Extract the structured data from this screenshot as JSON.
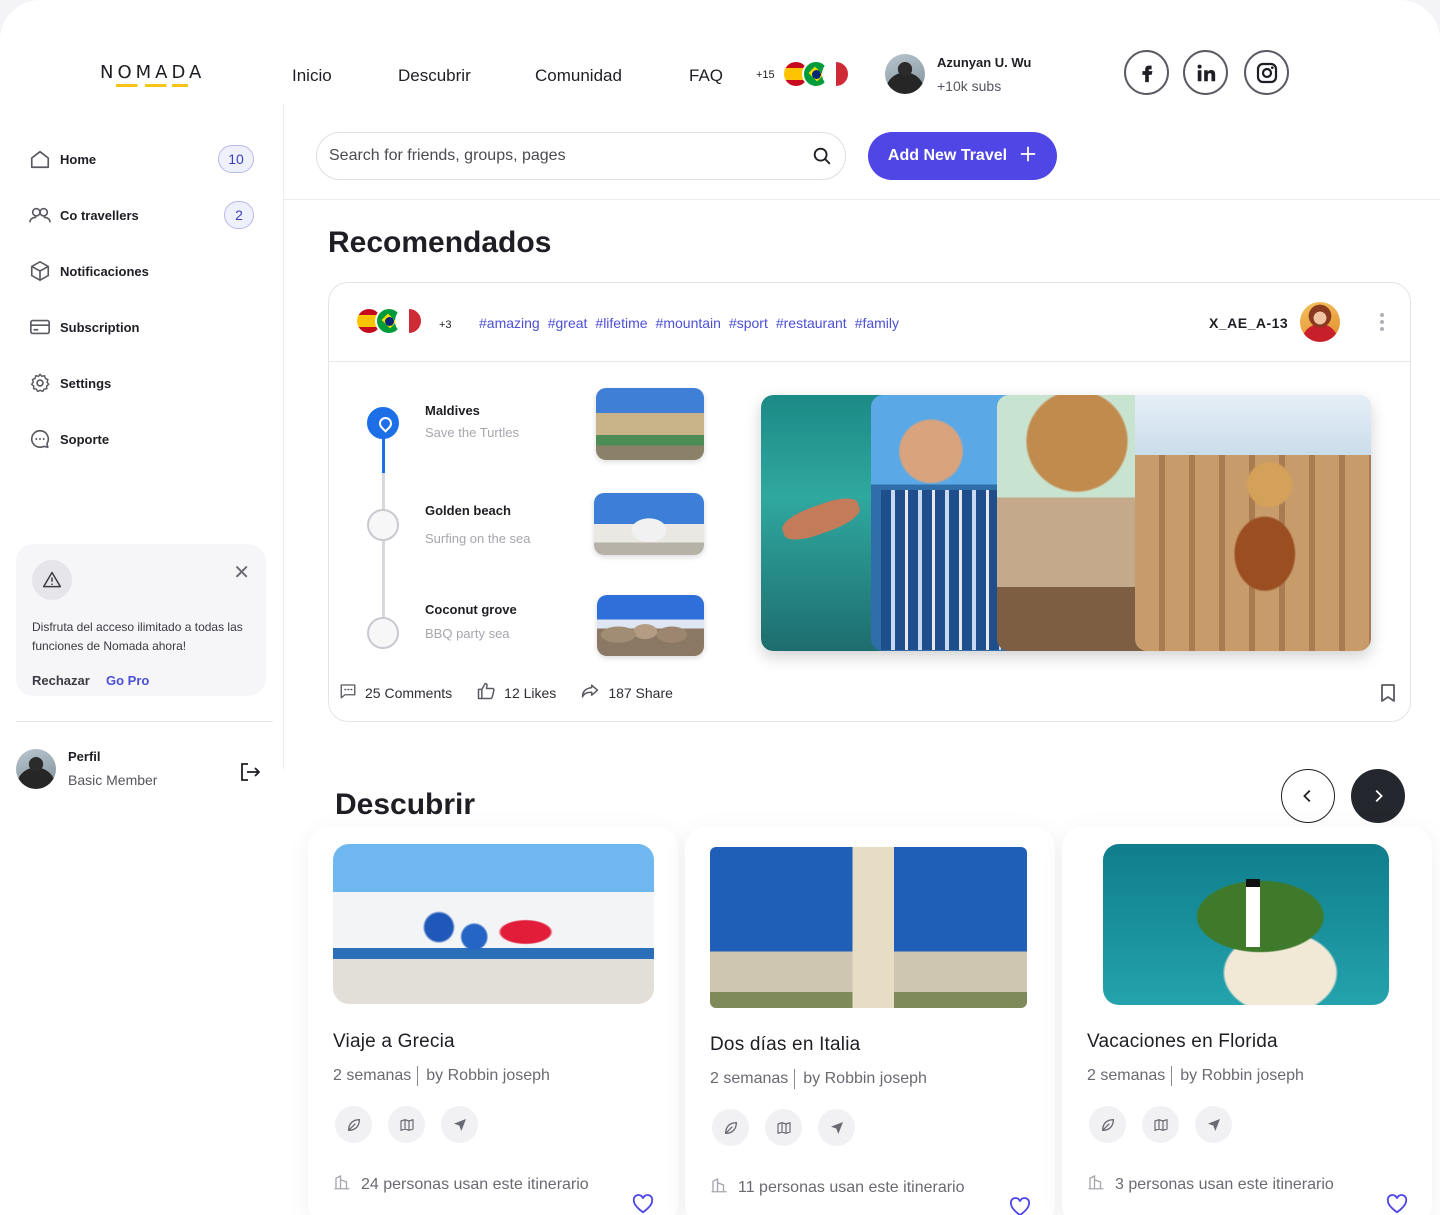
{
  "brand": {
    "logo_text": "NOMADA",
    "accent": "#4f46e5",
    "logo_accent": "#f5c518"
  },
  "nav": {
    "items": [
      "Inicio",
      "Descubrir",
      "Comunidad",
      "FAQ"
    ]
  },
  "languages": {
    "extra_count": "+15",
    "flags": [
      "flag-spain-icon",
      "flag-brazil-icon",
      "flag-italy-icon"
    ]
  },
  "user": {
    "name": "Azunyan U. Wu",
    "subs": "+10k subs"
  },
  "social": [
    "facebook-icon",
    "linkedin-icon",
    "instagram-icon"
  ],
  "sidebar": {
    "items": [
      {
        "label": "Home",
        "icon": "home-icon",
        "badge": "10"
      },
      {
        "label": "Co travellers",
        "icon": "users-icon",
        "badge": "2"
      },
      {
        "label": "Notificaciones",
        "icon": "cube-icon"
      },
      {
        "label": "Subscription",
        "icon": "card-icon"
      },
      {
        "label": "Settings",
        "icon": "gear-icon"
      },
      {
        "label": "Soporte",
        "icon": "chat-icon"
      }
    ],
    "promo": {
      "text": "Disfruta del acceso ilimitado a todas las funciones de Nomada ahora!",
      "reject": "Rechazar",
      "go_pro": "Go Pro"
    },
    "profile": {
      "name": "Perfil",
      "role": "Basic Member"
    }
  },
  "search": {
    "placeholder": "Search for friends, groups, pages",
    "value": ""
  },
  "add_button": {
    "label": "Add New Travel"
  },
  "recommended": {
    "title": "Recomendados",
    "flags_extra": "+3",
    "tags": [
      "#amazing",
      "#great",
      "#lifetime",
      "#mountain",
      "#sport",
      "#restaurant",
      "#family"
    ],
    "author": "X_AE_A-13",
    "stops": [
      {
        "title": "Maldives",
        "subtitle": "Save the Turtles",
        "active": true
      },
      {
        "title": "Golden beach",
        "subtitle": "Surfing on the sea",
        "active": false
      },
      {
        "title": "Coconut grove",
        "subtitle": "BBQ party  sea",
        "active": false
      }
    ],
    "comments": "25 Comments",
    "likes": "12 Likes",
    "shares": "187 Share"
  },
  "discover": {
    "title": "Descubrir",
    "cards": [
      {
        "title": "Viaje a Grecia",
        "duration": "2 semanas",
        "author": "by Robbin joseph",
        "usage": "24 personas  usan este itinerario"
      },
      {
        "title": "Dos días en Italia",
        "duration": "2 semanas",
        "author": "by Robbin joseph",
        "usage": "11 personas  usan este itinerario"
      },
      {
        "title": "Vacaciones en Florida",
        "duration": "2 semanas",
        "author": "by Robbin joseph",
        "usage": "3 personas  usan este itinerario"
      }
    ]
  }
}
